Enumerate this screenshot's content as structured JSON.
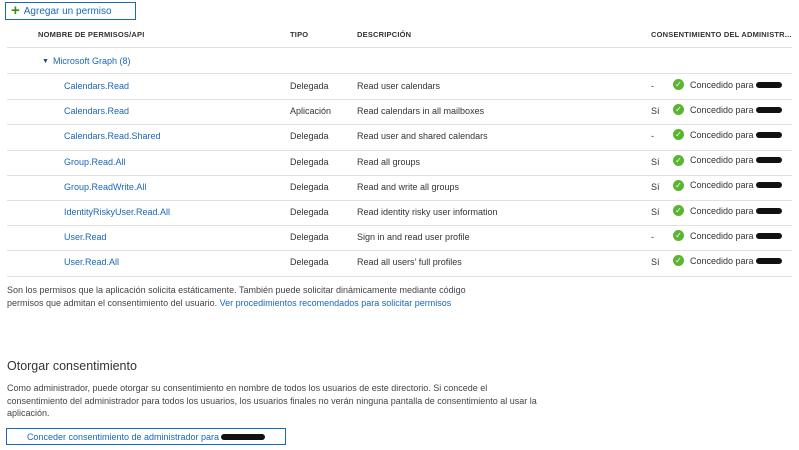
{
  "toolbar": {
    "add_permission_label": "Agregar un permiso"
  },
  "columns": {
    "name": "NOMBRE DE PERMISOS/API",
    "type": "TIPO",
    "description": "DESCRIPCIÓN",
    "admin_consent": "CONSENTIMIENTO DEL ADMINISTR..."
  },
  "group": {
    "label": "Microsoft Graph (8)"
  },
  "rows": [
    {
      "name": "Calendars.Read",
      "type": "Delegada",
      "description": "Read user calendars",
      "admin_required": "-",
      "status": "Concedido para"
    },
    {
      "name": "Calendars.Read",
      "type": "Aplicación",
      "description": "Read calendars in all mailboxes",
      "admin_required": "Sí",
      "status": "Concedido para"
    },
    {
      "name": "Calendars.Read.Shared",
      "type": "Delegada",
      "description": "Read user and shared calendars",
      "admin_required": "-",
      "status": "Concedido para"
    },
    {
      "name": "Group.Read.All",
      "type": "Delegada",
      "description": "Read all groups",
      "admin_required": "Sí",
      "status": "Concedido para"
    },
    {
      "name": "Group.ReadWrite.All",
      "type": "Delegada",
      "description": "Read and write all groups",
      "admin_required": "Sí",
      "status": "Concedido para"
    },
    {
      "name": "IdentityRiskyUser.Read.All",
      "type": "Delegada",
      "description": "Read identity risky user information",
      "admin_required": "Sí",
      "status": "Concedido para"
    },
    {
      "name": "User.Read",
      "type": "Delegada",
      "description": "Sign in and read user profile",
      "admin_required": "-",
      "status": "Concedido para"
    },
    {
      "name": "User.Read.All",
      "type": "Delegada",
      "description": "Read all users' full profiles",
      "admin_required": "Sí",
      "status": "Concedido para"
    }
  ],
  "note": {
    "text": "Son los permisos que la aplicación solicita estáticamente. También puede solicitar dinámicamente mediante código permisos que admitan el consentimiento del usuario. ",
    "link": "Ver procedimientos recomendados para solicitar permisos"
  },
  "consent": {
    "title": "Otorgar consentimiento",
    "description": "Como administrador, puede otorgar su consentimiento en nombre de todos los usuarios de este directorio. Si concede el consentimiento del administrador para todos los usuarios, los usuarios finales no verán ninguna pantalla de consentimiento al usar la aplicación.",
    "button_label": "Conceder consentimiento de administrador para"
  },
  "colors": {
    "accent": "#1a66b8",
    "success": "#5bb530"
  }
}
